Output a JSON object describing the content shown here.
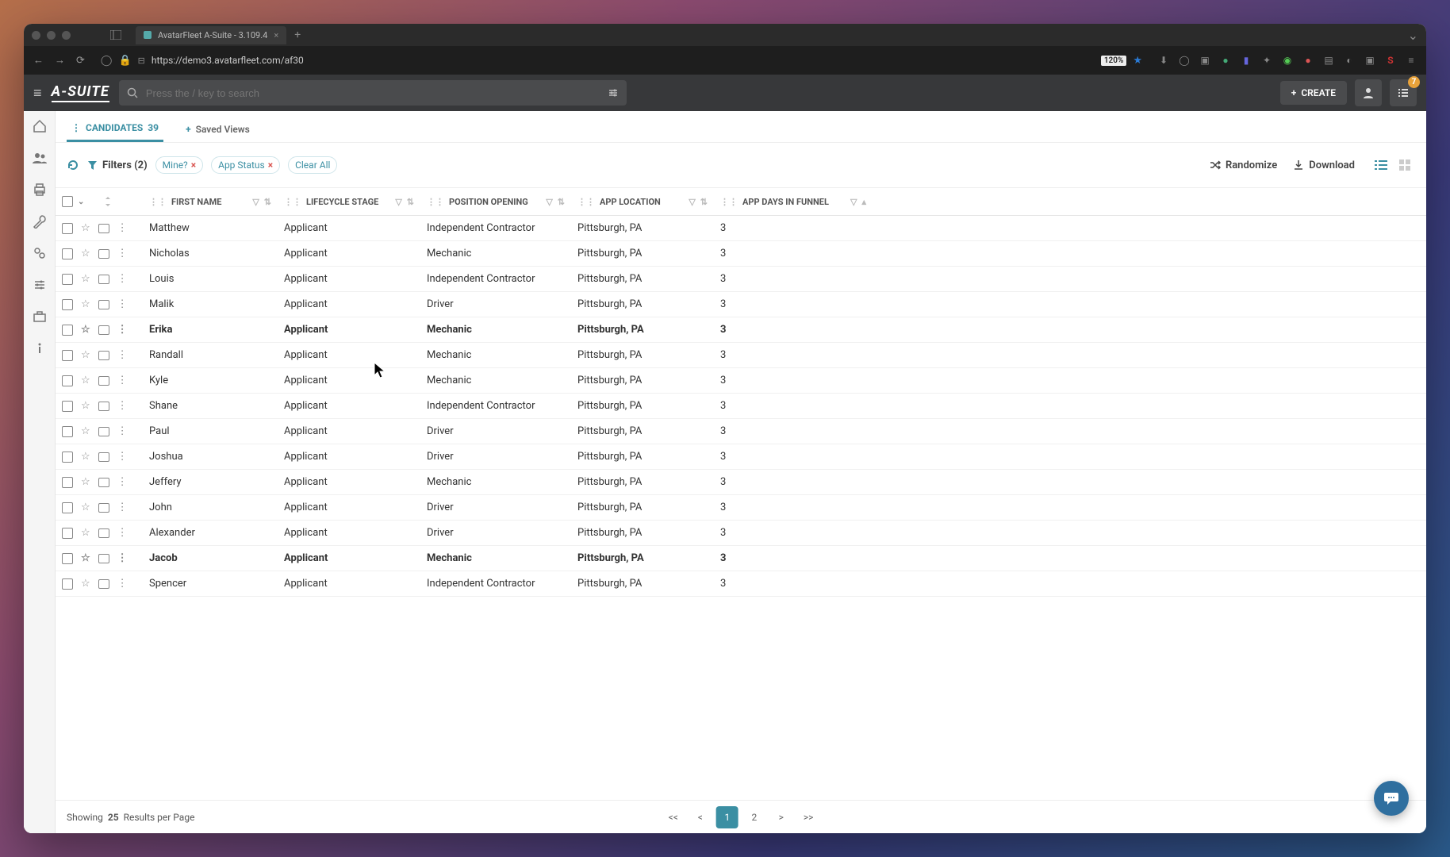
{
  "browser": {
    "tab_title": "AvatarFleet A-Suite - 3.109.4",
    "url": "https://demo3.avatarfleet.com/af30",
    "zoom": "120%"
  },
  "header": {
    "logo": "A-SUITE",
    "search_placeholder": "Press the / key to search",
    "create_label": "CREATE",
    "notification_count": "7"
  },
  "tabs": {
    "active_label": "CANDIDATES",
    "active_count": "39",
    "saved_views_label": "Saved Views"
  },
  "filters": {
    "label": "Filters (2)",
    "chips": [
      "Mine?",
      "App Status"
    ],
    "clear_all": "Clear All"
  },
  "actions": {
    "randomize": "Randomize",
    "download": "Download"
  },
  "columns": {
    "first_name": "FIRST NAME",
    "lifecycle_stage": "LIFECYCLE STAGE",
    "position_opening": "POSITION OPENING",
    "app_location": "APP LOCATION",
    "app_days": "APP DAYS IN FUNNEL"
  },
  "rows": [
    {
      "first": "Matthew",
      "stage": "Applicant",
      "pos": "Independent Contractor",
      "loc": "Pittsburgh, PA",
      "days": "3",
      "bold": false
    },
    {
      "first": "Nicholas",
      "stage": "Applicant",
      "pos": "Mechanic",
      "loc": "Pittsburgh, PA",
      "days": "3",
      "bold": false
    },
    {
      "first": "Louis",
      "stage": "Applicant",
      "pos": "Independent Contractor",
      "loc": "Pittsburgh, PA",
      "days": "3",
      "bold": false
    },
    {
      "first": "Malik",
      "stage": "Applicant",
      "pos": "Driver",
      "loc": "Pittsburgh, PA",
      "days": "3",
      "bold": false
    },
    {
      "first": "Erika",
      "stage": "Applicant",
      "pos": "Mechanic",
      "loc": "Pittsburgh, PA",
      "days": "3",
      "bold": true
    },
    {
      "first": "Randall",
      "stage": "Applicant",
      "pos": "Mechanic",
      "loc": "Pittsburgh, PA",
      "days": "3",
      "bold": false
    },
    {
      "first": "Kyle",
      "stage": "Applicant",
      "pos": "Mechanic",
      "loc": "Pittsburgh, PA",
      "days": "3",
      "bold": false
    },
    {
      "first": "Shane",
      "stage": "Applicant",
      "pos": "Independent Contractor",
      "loc": "Pittsburgh, PA",
      "days": "3",
      "bold": false
    },
    {
      "first": "Paul",
      "stage": "Applicant",
      "pos": "Driver",
      "loc": "Pittsburgh, PA",
      "days": "3",
      "bold": false
    },
    {
      "first": "Joshua",
      "stage": "Applicant",
      "pos": "Driver",
      "loc": "Pittsburgh, PA",
      "days": "3",
      "bold": false
    },
    {
      "first": "Jeffery",
      "stage": "Applicant",
      "pos": "Mechanic",
      "loc": "Pittsburgh, PA",
      "days": "3",
      "bold": false
    },
    {
      "first": "John",
      "stage": "Applicant",
      "pos": "Driver",
      "loc": "Pittsburgh, PA",
      "days": "3",
      "bold": false
    },
    {
      "first": "Alexander",
      "stage": "Applicant",
      "pos": "Driver",
      "loc": "Pittsburgh, PA",
      "days": "3",
      "bold": false
    },
    {
      "first": "Jacob",
      "stage": "Applicant",
      "pos": "Mechanic",
      "loc": "Pittsburgh, PA",
      "days": "3",
      "bold": true
    },
    {
      "first": "Spencer",
      "stage": "Applicant",
      "pos": "Independent Contractor",
      "loc": "Pittsburgh, PA",
      "days": "3",
      "bold": false
    }
  ],
  "footer": {
    "showing": "Showing",
    "count": "25",
    "rpp": "Results per Page",
    "pages": [
      "1",
      "2"
    ],
    "first": "<<",
    "prev": "<",
    "next": ">",
    "last": ">>"
  }
}
